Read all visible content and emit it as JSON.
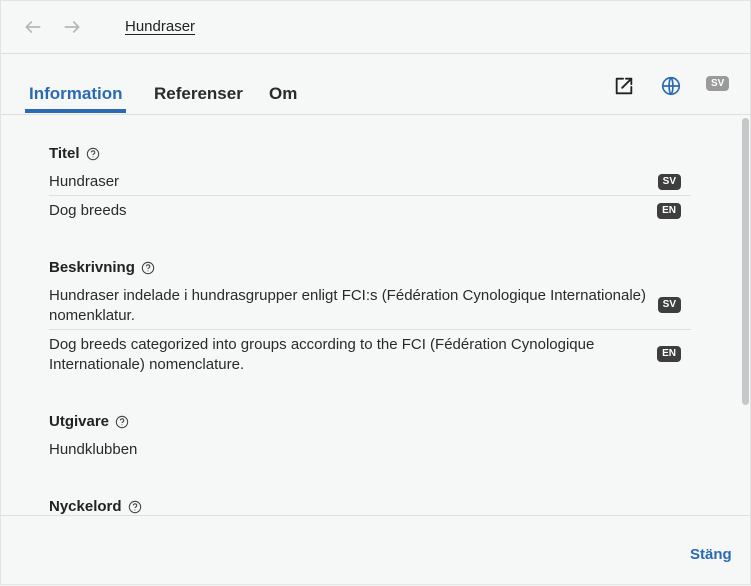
{
  "header": {
    "breadcrumb": "Hundraser"
  },
  "tabs": [
    {
      "label": "Information",
      "active": true
    },
    {
      "label": "Referenser",
      "active": false
    },
    {
      "label": "Om",
      "active": false
    }
  ],
  "toolbar": {
    "open_external_icon": "external-link-icon",
    "language_icon": "globe-icon",
    "language_code": "SV"
  },
  "sections": {
    "title": {
      "heading": "Titel",
      "values": [
        {
          "text": "Hundraser",
          "lang": "SV"
        },
        {
          "text": "Dog breeds",
          "lang": "EN"
        }
      ]
    },
    "description": {
      "heading": "Beskrivning",
      "values": [
        {
          "text": "Hundraser indelade i hundrasgrupper enligt FCI:s (Fédération Cynologique Internationale) nomenklatur.",
          "lang": "SV"
        },
        {
          "text": "Dog breeds categorized into groups according to the FCI (Fédération Cynologique Internationale) nomenclature.",
          "lang": "EN"
        }
      ]
    },
    "publisher": {
      "heading": "Utgivare",
      "value": "Hundklubben"
    },
    "keywords": {
      "heading": "Nyckelord"
    }
  },
  "footer": {
    "close_label": "Stäng"
  },
  "colors": {
    "accent": "#2a6ab3",
    "badge_bg": "#3e3e3e",
    "background": "#f6f7f7"
  }
}
